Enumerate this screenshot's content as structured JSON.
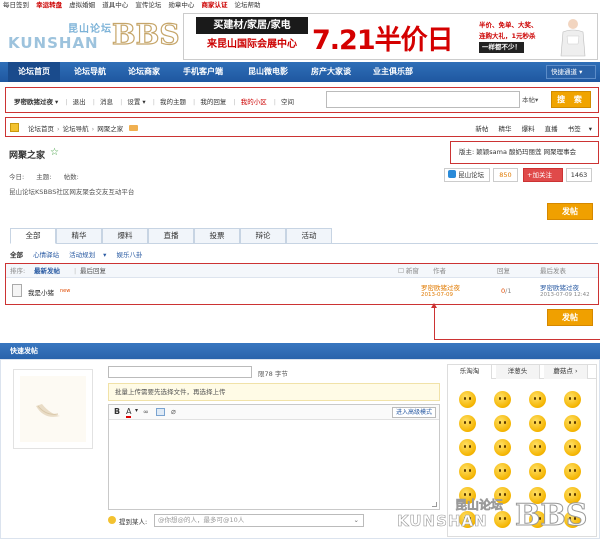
{
  "topbar": {
    "items": [
      "每日签到",
      "幸运转盘",
      "虚拟婚姻",
      "道具中心",
      "宣传论坛",
      "勋章中心",
      "商家认证",
      "论坛帮助"
    ]
  },
  "logo": {
    "cn": "昆山论坛",
    "en": "KUNSHAN",
    "bbs": "BBS"
  },
  "banner": {
    "line1": "买建材/家居/家电",
    "line2": "来昆山国际会展中心",
    "headline": "7.21半价日",
    "side1": "半价、免单、大奖、",
    "side2": "连购大礼，1元秒杀",
    "side3": "一样都不少！"
  },
  "nav": {
    "items": [
      "论坛首页",
      "论坛导航",
      "论坛商家",
      "手机客户端",
      "昆山微电影",
      "房产大家谈",
      "业主俱乐部"
    ],
    "quick": "快捷通道"
  },
  "userbar": {
    "username": "罗密欧猪过夜",
    "links": [
      "退出",
      "消息",
      "设置",
      "我的主题",
      "我的回复",
      "我的小区",
      "空间"
    ],
    "search_type": "本帖",
    "search_button": "搜 索"
  },
  "breadcrumb": {
    "path": [
      "论坛首页",
      "论坛导航",
      "网聚之家"
    ],
    "right": [
      "新帖",
      "精华",
      "爆料",
      "直播",
      "书签"
    ]
  },
  "forum": {
    "title": "网聚之家",
    "moderators": "版主: 颖颖sama 酸奶玛丽莲 网聚理事会",
    "today_label": "今日:",
    "topics_label": "主题:",
    "posts_label": "帖数:",
    "description": "昆山论坛KSBBS社区网友聚会交友互动平台",
    "share_label": "昆山论坛",
    "share_count": "850",
    "follow_label": "加关注",
    "follow_count": "1463",
    "post_button": "发帖"
  },
  "tabs": [
    "全部",
    "精华",
    "爆料",
    "直播",
    "投票",
    "辩论",
    "活动"
  ],
  "subtabs": [
    "全部",
    "心情驿站",
    "活动规划",
    "娱乐八卦"
  ],
  "list": {
    "head": {
      "sort": "排序:",
      "latest_post": "最新发帖",
      "latest_reply": "最后回复",
      "new_window": "新窗",
      "author": "作者",
      "replies": "回复",
      "last_post": "最后发表"
    },
    "rows": [
      {
        "title": "我是小猪",
        "badge": "new",
        "author": "罗密欧猪过夜",
        "date": "2013-07-09",
        "replies": "0",
        "views": "1",
        "last_user": "罗密欧猪过夜",
        "last_time": "2013-07-09 12:42"
      }
    ]
  },
  "quickpost": {
    "title": "快速发帖",
    "char_limit": "限78 字节",
    "upload_note": "批量上传需要先选择文件，再选择上传",
    "advanced_mode": "进入高级模式",
    "mention_label": "提到某人:",
    "mention_placeholder": "@你想@的人，最多可@10人",
    "emoji_tabs": [
      "乐淘淘",
      "洋葱头",
      "蘑菇点"
    ]
  },
  "watermark": {
    "cn": "昆山论坛",
    "en": "KUNSHAN",
    "bbs": "BBS"
  }
}
